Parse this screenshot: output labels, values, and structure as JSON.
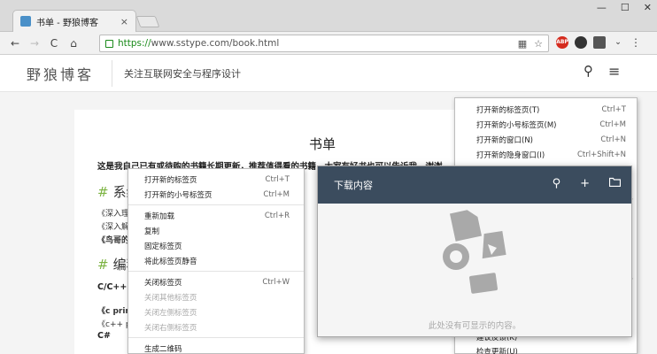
{
  "browser": {
    "tab_title": "书单 - 野狼博客",
    "tab_close": "×",
    "window_controls": [
      "—",
      "☐",
      "✕"
    ],
    "nav": {
      "back": "←",
      "forward": "→",
      "reload": "C",
      "home": "⌂"
    },
    "url_scheme": "https://",
    "url_rest": "www.sstype.com/book.html",
    "omnibox_icons": {
      "qr": "▦",
      "star": "☆"
    },
    "extensions": [
      {
        "name": "abp-icon",
        "label": "ABP",
        "color": "#d52b1e"
      },
      {
        "name": "dark-circle-icon",
        "label": "",
        "color": "#333333"
      },
      {
        "name": "window-icon",
        "label": "",
        "color": "#555555"
      },
      {
        "name": "chevron-icon",
        "label": "",
        "color": "#777777"
      }
    ],
    "menu_glyph": "⋮"
  },
  "site": {
    "logo": "野狼博客",
    "tagline": "关注互联网安全与程序设计",
    "search_icon": "⚲",
    "menu_icon": "≡"
  },
  "article": {
    "title": "书单",
    "intro": "这是我自己已有或待购的书籍长期更新，推荐值得看的书籍，大家有好书也可以告诉我，谢谢",
    "section1": "系统",
    "section2": "编程",
    "books1": [
      "《深入理",
      "《深入解",
      "《鸟哥的"
    ],
    "cat1": "C/C++",
    "books2": [
      "《c prin",
      "《c++ p"
    ],
    "cat2": "C#",
    "frag1": "了",
    "frag2": "刍"
  },
  "tab_menu": {
    "items": [
      {
        "label": "打开新的标签页",
        "shortcut": "Ctrl+T",
        "disabled": false
      },
      {
        "label": "打开新的小号标签页",
        "shortcut": "Ctrl+M",
        "disabled": false
      },
      {
        "sep": true
      },
      {
        "label": "重新加载",
        "shortcut": "Ctrl+R",
        "disabled": false
      },
      {
        "label": "复制",
        "shortcut": "",
        "disabled": false
      },
      {
        "label": "固定标签页",
        "shortcut": "",
        "disabled": false
      },
      {
        "label": "将此标签页静音",
        "shortcut": "",
        "disabled": false
      },
      {
        "sep": true
      },
      {
        "label": "关闭标签页",
        "shortcut": "Ctrl+W",
        "disabled": false
      },
      {
        "label": "关闭其他标签页",
        "shortcut": "",
        "disabled": true
      },
      {
        "label": "关闭左侧标签页",
        "shortcut": "",
        "disabled": true
      },
      {
        "label": "关闭右侧标签页",
        "shortcut": "",
        "disabled": true
      },
      {
        "sep": true
      },
      {
        "label": "生成二维码",
        "shortcut": "",
        "disabled": false
      }
    ]
  },
  "main_menu": {
    "items": [
      {
        "label": "打开新的标签页(T)",
        "shortcut": "Ctrl+T"
      },
      {
        "label": "打开新的小号标签页(M)",
        "shortcut": "Ctrl+M"
      },
      {
        "label": "打开新的窗口(N)",
        "shortcut": "Ctrl+N"
      },
      {
        "label": "打开新的隐身窗口(I)",
        "shortcut": "Ctrl+Shift+N"
      }
    ],
    "lower_items": [
      "建议反馈(K)",
      "检查更新(U)"
    ]
  },
  "downloads": {
    "title": "下载内容",
    "search_icon": "⚲",
    "add_icon": "+",
    "folder_icon": "▭",
    "empty_text": "此处没有可显示的内容。"
  },
  "colors": {
    "downloads_header": "#3b4c5e",
    "secure_green": "#1a8a1a",
    "section_hash": "#7cb342"
  }
}
